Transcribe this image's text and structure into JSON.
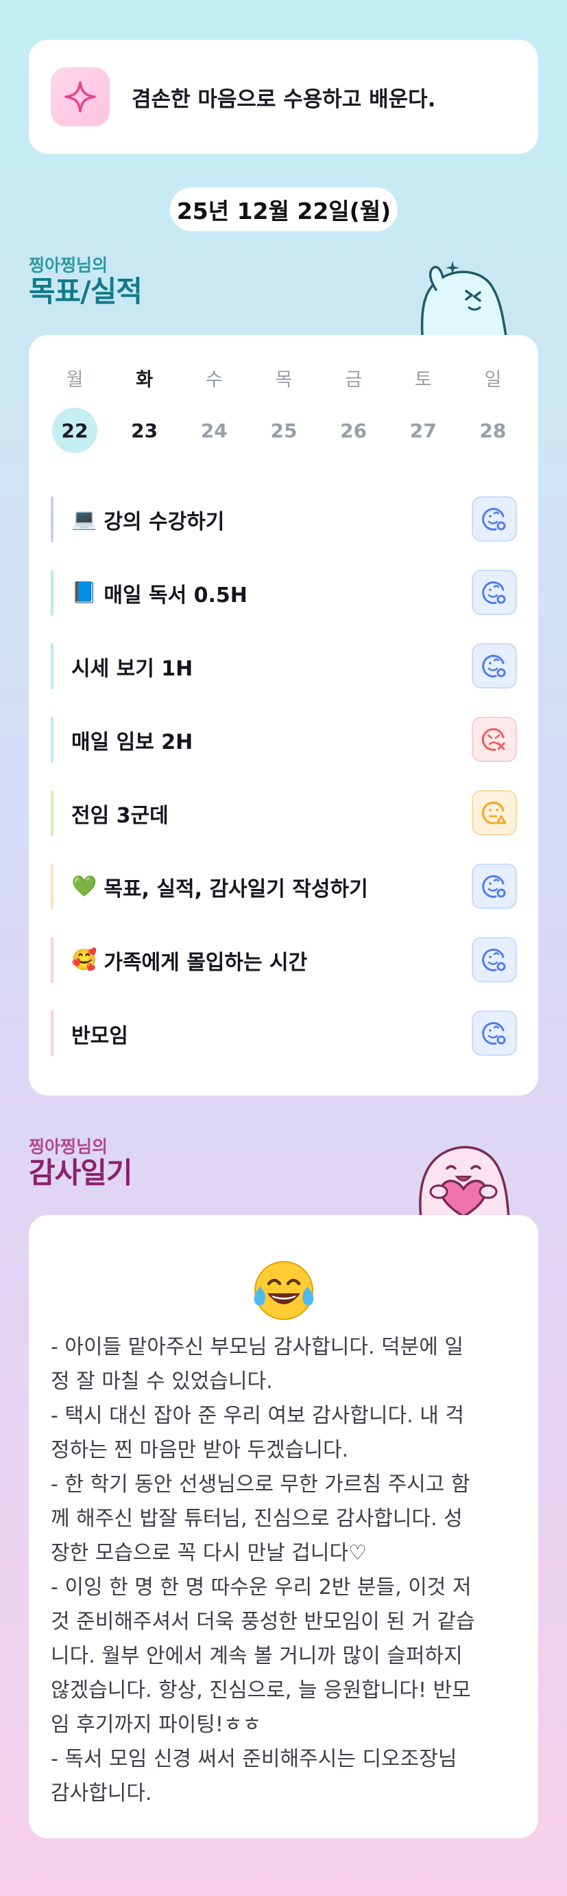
{
  "motto": {
    "text": "겸손한 마음으로 수용하고 배운다.",
    "icon": "sparkle-icon"
  },
  "date": "25년 12월 22일(월)",
  "goals_section": {
    "owner": "찡아찡님의",
    "title": "목표/실적"
  },
  "week": {
    "days": [
      {
        "name": "월",
        "num": "22",
        "today": true
      },
      {
        "name": "화",
        "num": "23",
        "active": true
      },
      {
        "name": "수",
        "num": "24"
      },
      {
        "name": "목",
        "num": "25"
      },
      {
        "name": "금",
        "num": "26"
      },
      {
        "name": "토",
        "num": "27"
      },
      {
        "name": "일",
        "num": "28"
      }
    ]
  },
  "goals": [
    {
      "emoji": "💻",
      "label": "강의 수강하기",
      "status": "done",
      "bar_color": "#c9d0f0"
    },
    {
      "emoji": "📘",
      "label": "매일 독서 0.5H",
      "status": "done",
      "bar_color": "#b9ece6"
    },
    {
      "emoji": "",
      "label": "시세 보기 1H",
      "status": "done",
      "bar_color": "#bfe9f1"
    },
    {
      "emoji": "",
      "label": "매일 임보 2H",
      "status": "fail",
      "bar_color": "#bfe9f1"
    },
    {
      "emoji": "",
      "label": "전임 3군데",
      "status": "partial",
      "bar_color": "#d5f0b4"
    },
    {
      "emoji": "💚",
      "label": "목표, 실적, 감사일기 작성하기",
      "status": "done",
      "bar_color": "#fde4c0"
    },
    {
      "emoji": "🥰",
      "label": "가족에게 몰입하는 시간",
      "status": "done",
      "bar_color": "#fccfd3"
    },
    {
      "emoji": "",
      "label": "반모임",
      "status": "done",
      "bar_color": "#fccfd3"
    }
  ],
  "status_colors": {
    "done": "#4f7df0",
    "fail": "#ef5a5f",
    "partial": "#f5a623"
  },
  "gratitude_section": {
    "owner": "찡아찡님의",
    "title": "감사일기",
    "emoji": "face-with-tears-of-joy-icon"
  },
  "gratitude_lines": [
    "- 아이들 맡아주신 부모님 감사합니다. 덕분에 일",
    "정 잘 마칠 수 있었습니다.",
    "- 택시 대신 잡아 준 우리 여보 감사합니다. 내 걱",
    "정하는 찐 마음만 받아 두겠습니다.",
    "- 한 학기 동안 선생님으로 무한 가르침 주시고 함",
    "께 해주신 밥잘 튜터님, 진심으로 감사합니다. 성",
    "장한 모습으로 꼭 다시 만날 겁니다♡",
    "- 이잉 한 명 한 명 따수운 우리 2반 분들, 이것 저",
    "것 준비해주셔서 더욱 풍성한 반모임이 된 거 같습",
    "니다. 월부 안에서 계속 볼 거니까 많이 슬퍼하지",
    "않겠습니다. 항상, 진심으로, 늘 응원합니다! 반모",
    "임 후기까지 파이팅!ㅎㅎ",
    "- 독서 모임 신경 써서 준비해주시는 디오조장님",
    "감사합니다."
  ]
}
